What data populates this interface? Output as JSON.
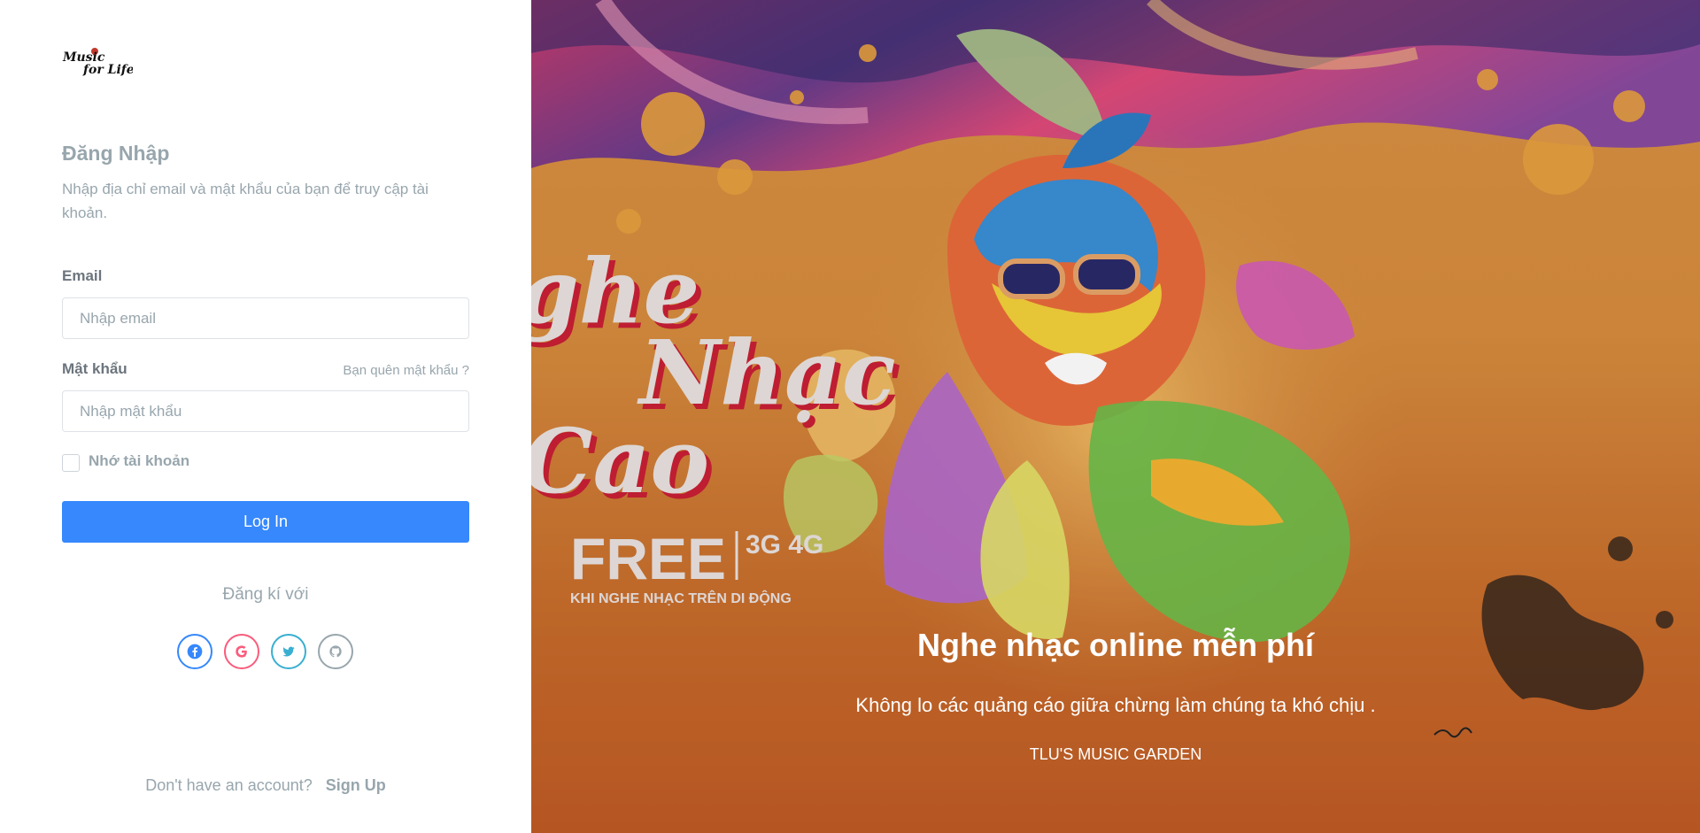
{
  "brand": {
    "logo_line1": "Music",
    "logo_line2": "for Life"
  },
  "login": {
    "title": "Đăng Nhập",
    "subtitle": "Nhập địa chỉ email và mật khẩu của bạn để truy cập tài khoản.",
    "email_label": "Email",
    "email_placeholder": "Nhập email",
    "password_label": "Mật khẩu",
    "forgot_link": "Bạn quên mật khẩu ?",
    "password_placeholder": "Nhập mật khẩu",
    "remember_label": "Nhớ tài khoản",
    "login_button": "Log In",
    "signup_with": "Đăng kí với",
    "socials": [
      "facebook-icon",
      "google-icon",
      "twitter-icon",
      "github-icon"
    ],
    "footer_text": "Don't have an account?",
    "signup_link": "Sign Up"
  },
  "hero": {
    "poster_line1": "ghe",
    "poster_line2": "Nhạc",
    "poster_line3": "Cao",
    "poster_free": "FREE",
    "poster_net": "3G 4G",
    "poster_tagline": "KHI NGHE NHẠC TRÊN DI ĐỘNG",
    "title": "Nghe nhạc online mễn phí",
    "subtitle": "Không lo các quảng cáo giữa chừng làm chúng ta khó chịu .",
    "credit": "TLU'S MUSIC GARDEN"
  },
  "colors": {
    "primary": "#3688fc",
    "muted": "#98a6ad",
    "hero_orange": "#d68c3e"
  }
}
